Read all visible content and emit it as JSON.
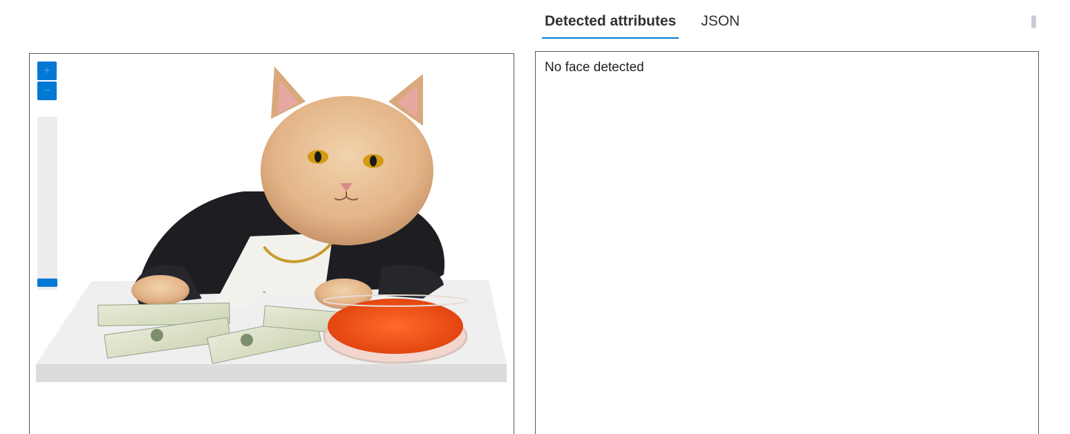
{
  "viewer": {
    "zoom_in_label": "+",
    "zoom_out_label": "−",
    "zoom_level": 0.0,
    "image": {
      "subject": "cat-in-suit-with-money-and-caviar"
    }
  },
  "tabs": [
    {
      "label": "Detected attributes",
      "active": true
    },
    {
      "label": "JSON",
      "active": false
    }
  ],
  "results": {
    "message": "No face detected"
  },
  "colors": {
    "accent": "#0078d4",
    "track": "#ececec",
    "border": "#555555"
  }
}
